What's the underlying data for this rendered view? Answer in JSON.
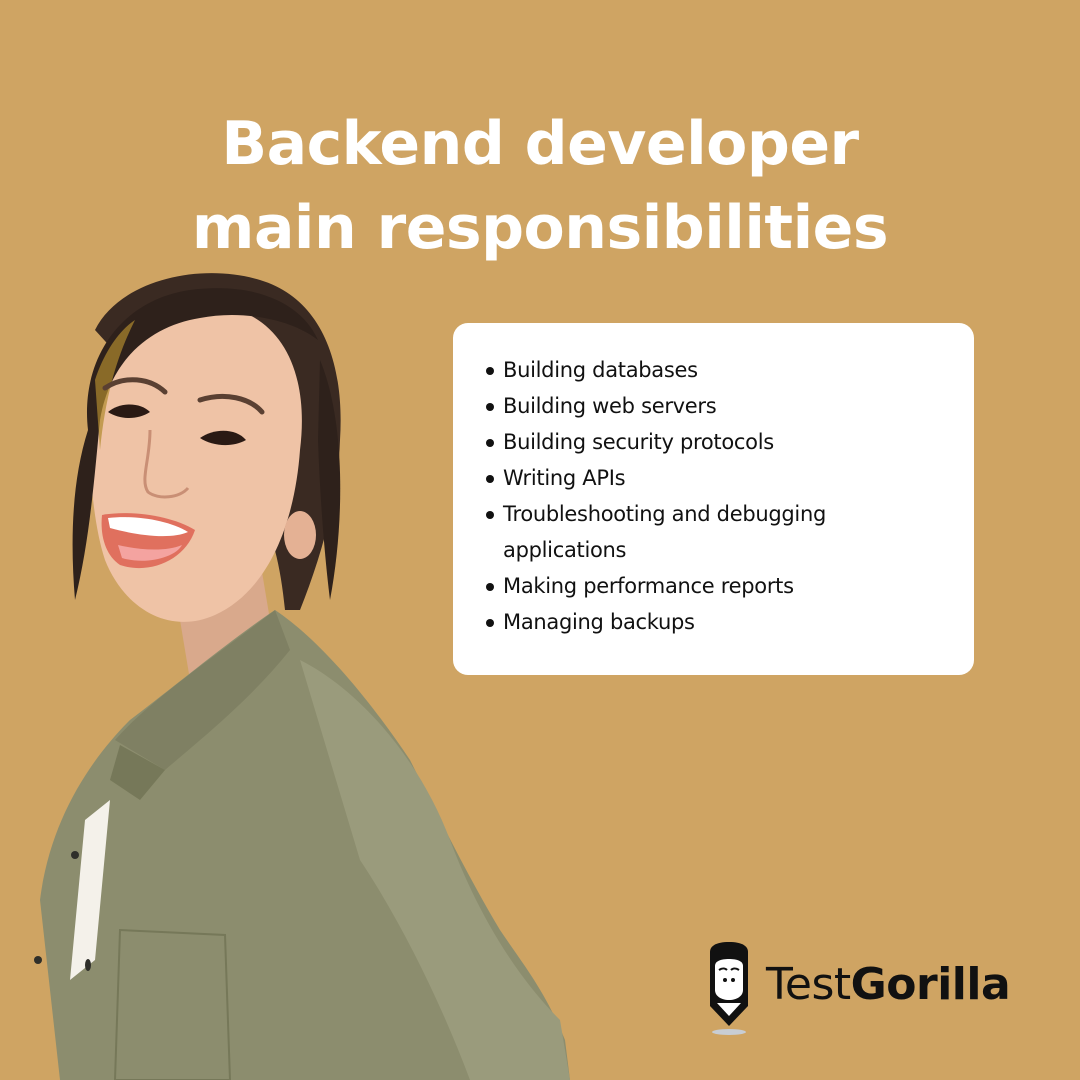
{
  "headline": {
    "line1": "Backend developer",
    "line2": "main responsibilities"
  },
  "card": {
    "items": [
      "Building databases",
      "Building web servers",
      "Building security protocols",
      "Writing APIs",
      "Troubleshooting and debugging applications",
      "Making performance reports",
      "Managing backups"
    ]
  },
  "photo": {
    "description": "smiling woman in olive green shirt looking over her shoulder"
  },
  "brand": {
    "name_light": "Test",
    "name_bold": "Gorilla",
    "logo_icon": "gorilla-pencil-icon"
  },
  "colors": {
    "background": "#CFA463",
    "card": "#FFFFFF",
    "headline": "#FFFFFF",
    "text": "#111111",
    "shirt": "#8C8D6E"
  }
}
